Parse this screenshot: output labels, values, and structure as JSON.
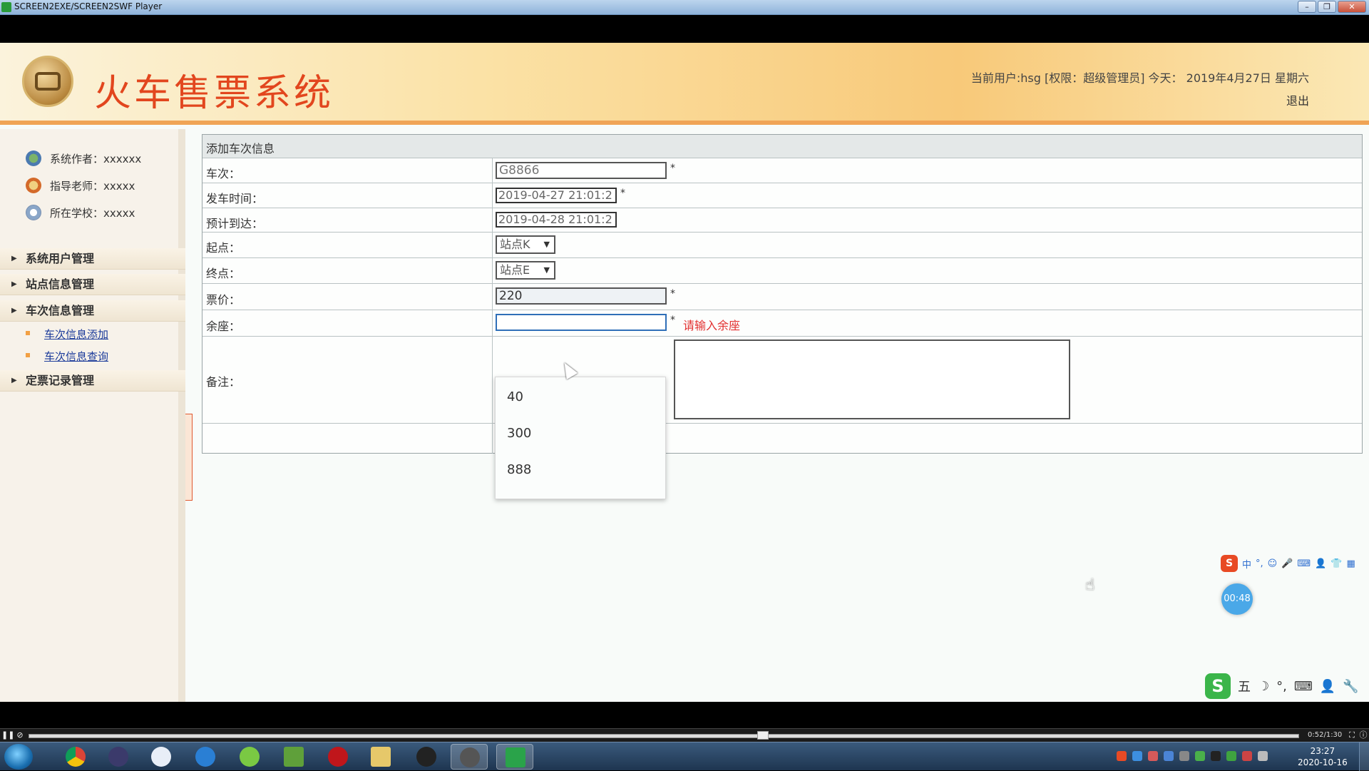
{
  "window": {
    "title": "SCREEN2EXE/SCREEN2SWF Player",
    "buttons": [
      "–",
      "❐",
      "✕"
    ]
  },
  "header": {
    "app_title": "火车售票系统",
    "user_info": "当前用户:hsg [权限：超级管理员] 今天： 2019年4月27日 星期六",
    "logout_label": "退出"
  },
  "sidebar": {
    "info": [
      {
        "label": "系统作者：xxxxxx",
        "icon": "author-icon"
      },
      {
        "label": "指导老师：xxxxx",
        "icon": "teacher-icon"
      },
      {
        "label": "所在学校：xxxxx",
        "icon": "school-icon"
      }
    ],
    "menu": [
      {
        "label": "系统用户管理"
      },
      {
        "label": "站点信息管理"
      },
      {
        "label": "车次信息管理",
        "subitems": [
          "车次信息添加",
          "车次信息查询"
        ]
      },
      {
        "label": "定票记录管理"
      }
    ]
  },
  "form": {
    "caption": "添加车次信息",
    "fields": {
      "train_no": {
        "label": "车次：",
        "value": "G8866"
      },
      "depart_time": {
        "label": "发车时间：",
        "value": "2019-04-27 21:01:2"
      },
      "arrive_time": {
        "label": "预计到达：",
        "value": "2019-04-28 21:01:2"
      },
      "start": {
        "label": "起点：",
        "value": "站点K"
      },
      "end": {
        "label": "终点：",
        "value": "站点E"
      },
      "price": {
        "label": "票价：",
        "value": "220"
      },
      "seats": {
        "label": "余座：",
        "value": "",
        "error": "请输入余座"
      },
      "remark": {
        "label": "备注：",
        "value": ""
      }
    },
    "required_mark": "*",
    "autocomplete_options": [
      "40",
      "300",
      "888"
    ]
  },
  "overlay": {
    "timer": "00:48",
    "ime_top": [
      "中",
      "°,",
      "☺",
      "🎤",
      "⌨",
      "👤",
      "👕",
      "▦"
    ],
    "ime_bottom": [
      "五",
      "☽",
      "°,",
      "⌨",
      "👤",
      "🔧"
    ]
  },
  "player": {
    "time": "0:52/1:30",
    "progress": 0.58
  },
  "taskbar": {
    "clock_time": "23:27",
    "clock_date": "2020-10-16"
  }
}
